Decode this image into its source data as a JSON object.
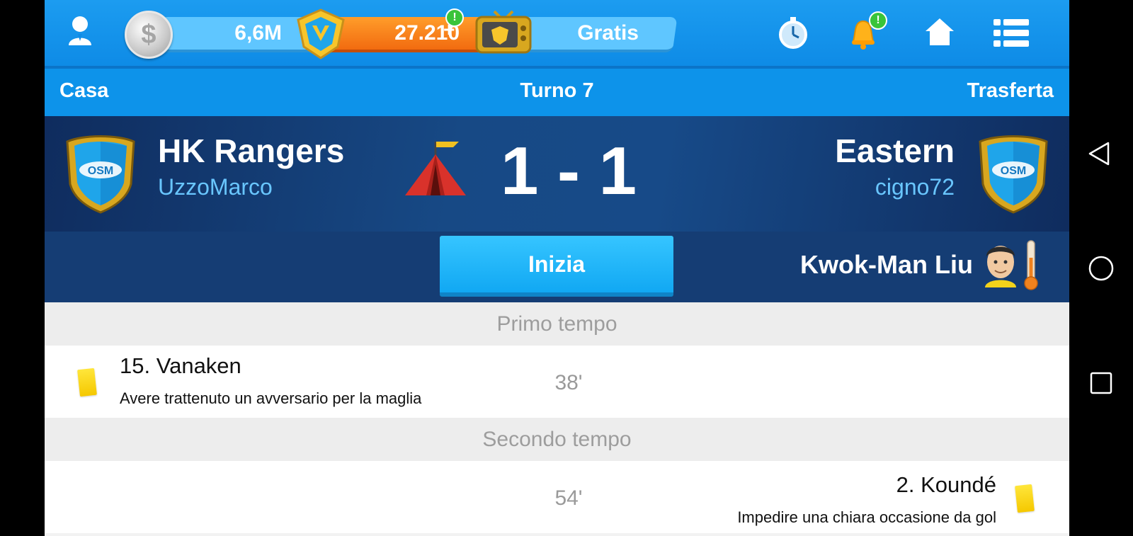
{
  "topbar": {
    "money": "6,6M",
    "boss_coins": "27.210",
    "boss_plus": "+",
    "boss_notification": "!",
    "tv_label": "Gratis",
    "bell_notification": "!",
    "icons": [
      "avatar-icon",
      "coin-icon",
      "boss-coin-icon",
      "tv-icon",
      "stopwatch-icon",
      "bell-icon",
      "home-icon",
      "menu-list-icon"
    ]
  },
  "header": {
    "home_label": "Casa",
    "round_label": "Turno 7",
    "away_label": "Trasferta"
  },
  "match": {
    "home_team": "HK Rangers",
    "home_manager": "UzzoMarco",
    "away_team": "Eastern",
    "away_manager": "cigno72",
    "score": "1 - 1",
    "shield_label": "OSM"
  },
  "actions": {
    "start_label": "Inizia",
    "referee_name": "Kwok-Man Liu"
  },
  "events": {
    "first_half_title": "Primo tempo",
    "second_half_title": "Secondo tempo",
    "items": [
      {
        "player": "15. Vanaken",
        "description": "Avere trattenuto un avversario per la maglia",
        "minute": "38'",
        "side": "home",
        "card": "yellow"
      },
      {
        "player": "2. Koundé",
        "description": "Impedire una chiara occasione da gol",
        "minute": "54'",
        "side": "away",
        "card": "yellow"
      }
    ]
  },
  "colors": {
    "topbar": "#1c9cf0",
    "header": "#0d93ea",
    "panel_dark": "#153d74",
    "button": "#1cb2f7",
    "manager_text": "#69c6ff",
    "yellow_card": "#f5c800"
  }
}
